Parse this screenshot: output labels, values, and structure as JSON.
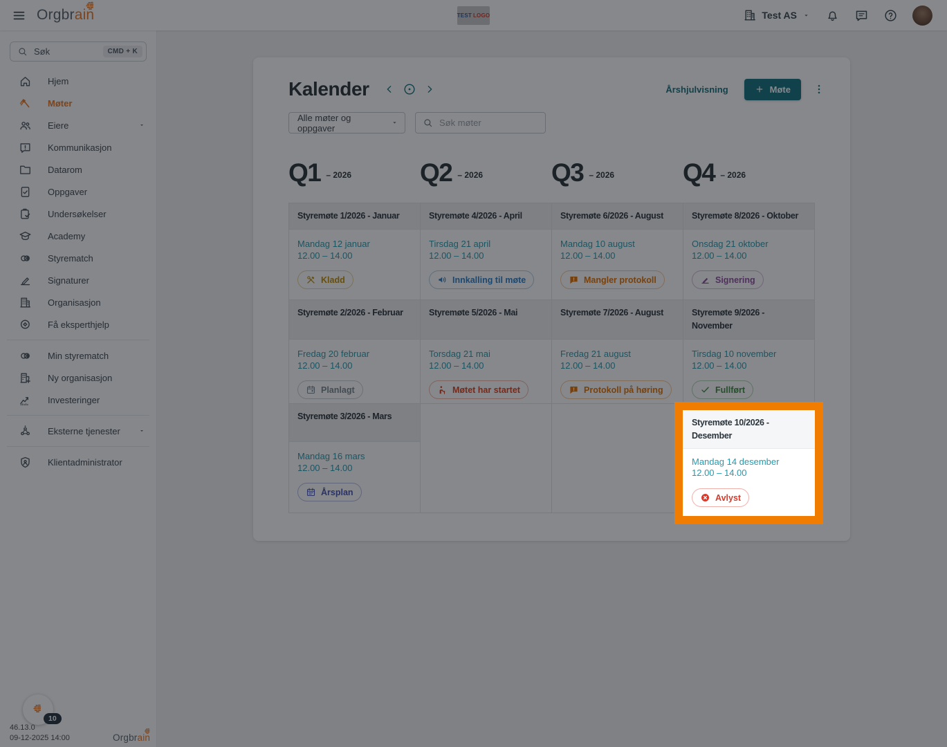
{
  "colors": {
    "accent_teal": "#12707e",
    "date_teal": "#2699ad",
    "active_orange": "#e87722",
    "highlight_orange": "#f07d00"
  },
  "topbar": {
    "logo_prefix": "Orgbr",
    "logo_suffix": "ain",
    "center_logo_word1": "TEST",
    "center_logo_word2": "LOGO",
    "org_selector_label": "Test AS",
    "right_icons": [
      "building-icon",
      "caret-down-icon",
      "bell-icon",
      "chat-icon",
      "help-icon",
      "avatar"
    ]
  },
  "sidebar": {
    "search_label": "Søk",
    "search_shortcut": "CMD + K",
    "groups": [
      {
        "items": [
          {
            "label": "Hjem",
            "icon": "home-icon"
          },
          {
            "label": "Møter",
            "icon": "gavel-icon",
            "active": true
          },
          {
            "label": "Eiere",
            "icon": "people-icon",
            "caret": true
          },
          {
            "label": "Kommunikasjon",
            "icon": "chat-alert-icon"
          },
          {
            "label": "Datarom",
            "icon": "folder-icon"
          },
          {
            "label": "Oppgaver",
            "icon": "task-icon"
          },
          {
            "label": "Undersøkelser",
            "icon": "clipboard-check-icon"
          },
          {
            "label": "Academy",
            "icon": "graduation-cap-icon"
          },
          {
            "label": "Styrematch",
            "icon": "styrematch-icon"
          },
          {
            "label": "Signaturer",
            "icon": "pen-icon"
          },
          {
            "label": "Organisasjon",
            "icon": "building-icon"
          },
          {
            "label": "Få eksperthjelp",
            "icon": "expert-icon"
          }
        ]
      },
      {
        "items": [
          {
            "label": "Min styrematch",
            "icon": "styrematch-icon"
          },
          {
            "label": "Ny organisasjon",
            "icon": "building-plus-icon"
          },
          {
            "label": "Investeringer",
            "icon": "chart-icon"
          }
        ]
      },
      {
        "items": [
          {
            "label": "Eksterne tjenester",
            "icon": "external-services-icon",
            "caret": true
          }
        ]
      },
      {
        "items": [
          {
            "label": "Klientadministrator",
            "icon": "shield-icon"
          }
        ]
      }
    ],
    "footer": {
      "badge_count": "10",
      "version": "46.13.0",
      "timestamp": "09-12-2025 14:00",
      "logo_prefix": "Orgbr",
      "logo_suffix": "ain"
    }
  },
  "calendar": {
    "title": "Kalender",
    "year_view_label": "Årshjulvisning",
    "new_meeting_label": "Møte",
    "filter_value": "Alle møter og oppgaver",
    "search_placeholder": "Søk møter",
    "quarters": [
      {
        "q": "Q1",
        "year": "– 2026"
      },
      {
        "q": "Q2",
        "year": "– 2026"
      },
      {
        "q": "Q3",
        "year": "– 2026"
      },
      {
        "q": "Q4",
        "year": "– 2026"
      }
    ],
    "rows": [
      [
        {
          "title": "Styremøte 1/2026 - Januar",
          "date": "Mandag 12 januar",
          "time": "12.00 – 14.00",
          "badge": {
            "label": "Kladd",
            "icon": "tools-icon",
            "color": "#bd8a00"
          }
        },
        {
          "title": "Styremøte 4/2026 - April",
          "date": "Tirsdag 21 april",
          "time": "12.00 – 14.00",
          "badge": {
            "label": "Innkalling til møte",
            "icon": "megaphone-icon",
            "color": "#2c7cc4"
          }
        },
        {
          "title": "Styremøte 6/2026 - August",
          "date": "Mandag 10 august",
          "time": "12.00 – 14.00",
          "badge": {
            "label": "Mangler protokoll",
            "icon": "protocol-alert-icon",
            "color": "#e07000"
          }
        },
        {
          "title": "Styremøte 8/2026 - Oktober",
          "date": "Onsdag 21 oktober",
          "time": "12.00 – 14.00",
          "badge": {
            "label": "Signering",
            "icon": "sign-pen-icon",
            "color": "#8a4f9e"
          }
        }
      ],
      [
        {
          "title": "Styremøte 2/2026 - Februar",
          "date": "Fredag 20 februar",
          "time": "12.00 – 14.00",
          "badge": {
            "label": "Planlagt",
            "icon": "calendar-icon",
            "color": "#76848f"
          }
        },
        {
          "title": "Styremøte 5/2026 - Mai",
          "date": "Torsdag 21 mai",
          "time": "12.00 – 14.00",
          "badge": {
            "label": "Møtet har startet",
            "icon": "presenter-icon",
            "color": "#d8431f"
          }
        },
        {
          "title": "Styremøte 7/2026 - August",
          "date": "Fredag 21 august",
          "time": "12.00 – 14.00",
          "badge": {
            "label": "Protokoll på høring",
            "icon": "protocol-alert-icon",
            "color": "#e07000"
          }
        },
        {
          "title": "Styremøte 9/2026 - November",
          "date": "Tirsdag 10 november",
          "time": "12.00 – 14.00",
          "badge": {
            "label": "Fullført",
            "icon": "check-icon",
            "color": "#3a8a3e"
          }
        }
      ],
      [
        {
          "title": "Styremøte 3/2026 - Mars",
          "date": "Mandag 16 mars",
          "time": "12.00 – 14.00",
          "badge": {
            "label": "Årsplan",
            "icon": "calendar-year-icon",
            "color": "#4353b4"
          }
        },
        null,
        null,
        {
          "title": "Styremøte 10/2026 - Desember",
          "date": "Mandag 14 desember",
          "time": "12.00 – 14.00",
          "badge": {
            "label": "Avlyst",
            "icon": "cancel-icon",
            "color": "#d93a2b"
          },
          "highlighted": true
        }
      ]
    ]
  }
}
